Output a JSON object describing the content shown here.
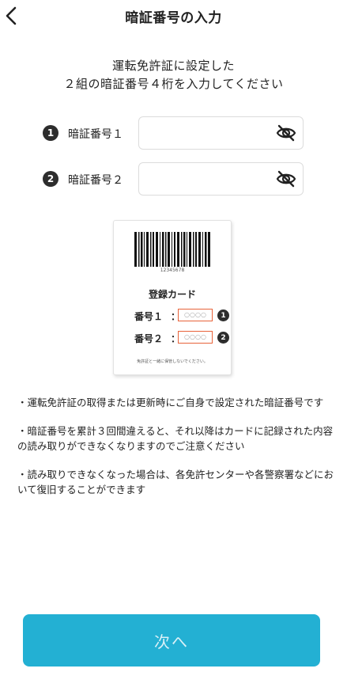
{
  "header": {
    "title": "暗証番号の入力",
    "back_icon": "chevron-left-icon"
  },
  "intro": {
    "line1": "運転免許証に設定した",
    "line2": "２組の暗証番号４桁を入力してください"
  },
  "pin_fields": [
    {
      "number": "1",
      "label": "暗証番号１",
      "value": "",
      "toggle_icon": "eye-off-icon"
    },
    {
      "number": "2",
      "label": "暗証番号２",
      "value": "",
      "toggle_icon": "eye-off-icon"
    }
  ],
  "card_illustration": {
    "barcode_number": "12345678",
    "title": "登録カード",
    "rows": [
      {
        "label": "番号１",
        "colon": "：",
        "placeholder": "○○○○",
        "number": "1"
      },
      {
        "label": "番号２",
        "colon": "：",
        "placeholder": "○○○○",
        "number": "2"
      }
    ],
    "footnote": "免許証と一緒に保管しないでください。"
  },
  "notes": [
    "・運転免許証の取得または更新時にご自身で設定された暗証番号です",
    "・暗証番号を累計３回間違えると、それ以降はカードに記録された内容の読み取りができなくなりますのでご注意ください",
    "・読み取りできなくなった場合は、各免許センターや各警察署などにおいて復旧することができます"
  ],
  "next_button": {
    "label": "次へ"
  },
  "colors": {
    "accent": "#23b0d3",
    "card_highlight": "#e8633a",
    "badge": "#2d2d2d"
  }
}
